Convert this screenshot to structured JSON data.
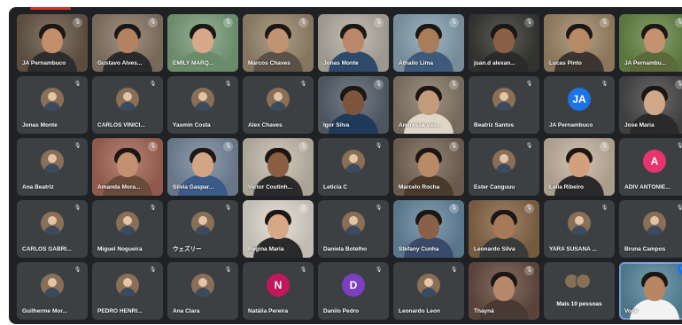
{
  "colors": {
    "tile_bg": "#3c4043",
    "frame_bg": "#1f2124",
    "self_outline": "#8ab4f8",
    "avatar_JA": "#1a73e8",
    "avatar_A": "#e8336d",
    "avatar_N": "#c2185b",
    "avatar_D": "#7b3fbf",
    "avatar_photo": "#8a6f57"
  },
  "participants": [
    {
      "name": "JA Pernambuco",
      "type": "video",
      "skin": "#c38e6c",
      "shirt": "#2d2d2d",
      "bg": "#6b5a4a"
    },
    {
      "name": "Gustavo Alves...",
      "type": "video",
      "skin": "#b48262",
      "shirt": "#2a2a2a",
      "bg": "#8c7b69"
    },
    {
      "name": "EMILY MARQ...",
      "type": "video",
      "skin": "#d8a88a",
      "shirt": "#6a8c6a",
      "bg": "#7ea37e"
    },
    {
      "name": "Marcos Chaves",
      "type": "video",
      "skin": "#c09372",
      "shirt": "#5a5247",
      "bg": "#9c8a70"
    },
    {
      "name": "Jonas Monte",
      "type": "video",
      "skin": "#b98868",
      "shirt": "#2d4a6b",
      "bg": "#b8b2a6"
    },
    {
      "name": "Athalio Lima",
      "type": "video",
      "skin": "#a97c5a",
      "shirt": "#3c5a7a",
      "bg": "#8aa4b2"
    },
    {
      "name": "juan.d alexan...",
      "type": "video",
      "skin": "#8a6147",
      "shirt": "#2a2a2a",
      "bg": "#3a3a36"
    },
    {
      "name": "Lucas Pinto",
      "type": "video",
      "skin": "#b78a66",
      "shirt": "#3a3530",
      "bg": "#a28a6a"
    },
    {
      "name": "JA Pernambu...",
      "type": "video",
      "skin": "#c49270",
      "shirt": "#5a6a3a",
      "bg": "#6a8a4a"
    },
    {
      "name": "Jonas Monte",
      "type": "photo"
    },
    {
      "name": "CARLOS VINICI...",
      "type": "photo"
    },
    {
      "name": "Yasmin Costa",
      "type": "photo"
    },
    {
      "name": "Alex Chaves",
      "type": "photo"
    },
    {
      "name": "Igor Silva",
      "type": "video",
      "skin": "#7c553c",
      "shirt": "#1f3a5a",
      "bg": "#5a6470"
    },
    {
      "name": "Andressa Vas...",
      "type": "video",
      "skin": "#c39a7e",
      "shirt": "#e0d6c8",
      "bg": "#8a7c6c"
    },
    {
      "name": "Beatriz Santos",
      "type": "photo"
    },
    {
      "name": "JA Pernambuco",
      "type": "letter",
      "letter": "JA",
      "color": "#1a73e8"
    },
    {
      "name": "Jose Maria",
      "type": "video",
      "skin": "#d0a888",
      "shirt": "#2a2a2a",
      "bg": "#4a4a4a"
    },
    {
      "name": "Ana Beatriz",
      "type": "photo"
    },
    {
      "name": "Amanda Mora...",
      "type": "video",
      "skin": "#c49070",
      "shirt": "#6a4a3a",
      "bg": "#a86a5a"
    },
    {
      "name": "Silvia Gaspar...",
      "type": "video",
      "skin": "#d4a584",
      "shirt": "#3a5a8a",
      "bg": "#7a8aa0"
    },
    {
      "name": "Victor Coutinh...",
      "type": "video",
      "skin": "#8a5e42",
      "shirt": "#2a2a2a",
      "bg": "#c8c0b0"
    },
    {
      "name": "Leticia C",
      "type": "photo"
    },
    {
      "name": "Marcelo Rocha",
      "type": "video",
      "skin": "#b88a68",
      "shirt": "#4a3a2a",
      "bg": "#7a6a5a"
    },
    {
      "name": "Ester Canguuu",
      "type": "photo"
    },
    {
      "name": "Leila Ribeiro",
      "type": "video",
      "skin": "#d2a07e",
      "shirt": "#2a2a2a",
      "bg": "#c8b8a4"
    },
    {
      "name": "ADIV ANTONIE...",
      "type": "letter",
      "letter": "A",
      "color": "#e8336d"
    },
    {
      "name": "CARLOS GABRI...",
      "type": "photo"
    },
    {
      "name": "Miguel Nogueira",
      "type": "photo"
    },
    {
      "name": "ウェズリー",
      "type": "photo"
    },
    {
      "name": "Regina Maria",
      "type": "video",
      "skin": "#d6a888",
      "shirt": "#2a2a2a",
      "bg": "#e2dcd2"
    },
    {
      "name": "Daniela Botelho",
      "type": "photo"
    },
    {
      "name": "Stefany Cunha",
      "type": "video",
      "skin": "#8a6048",
      "shirt": "#3a4a6a",
      "bg": "#6a8aa2"
    },
    {
      "name": "Leonardo Silva",
      "type": "video",
      "skin": "#a67a58",
      "shirt": "#3a3a3a",
      "bg": "#8a6a4a"
    },
    {
      "name": "YARA SUSANA ...",
      "type": "photo"
    },
    {
      "name": "Bruna Campos",
      "type": "photo"
    },
    {
      "name": "Guilherme Mor...",
      "type": "photo"
    },
    {
      "name": "PEDRO HENRI...",
      "type": "photo"
    },
    {
      "name": "Ana Clara",
      "type": "photo"
    },
    {
      "name": "Natália Pereira",
      "type": "letter",
      "letter": "N",
      "color": "#c2185b"
    },
    {
      "name": "Danilo Pedro",
      "type": "letter",
      "letter": "D",
      "color": "#7b3fbf"
    },
    {
      "name": "Leonardo Leon",
      "type": "photo"
    },
    {
      "name": "Thayná",
      "type": "video",
      "skin": "#b8876a",
      "shirt": "#4a3a34",
      "bg": "#6a5044"
    },
    {
      "name": "Mais 10 pessoas",
      "type": "more"
    },
    {
      "name": "Você",
      "type": "self",
      "skin": "#b98664",
      "shirt": "#f2f2f2",
      "bg": "#5a8aa0"
    }
  ]
}
